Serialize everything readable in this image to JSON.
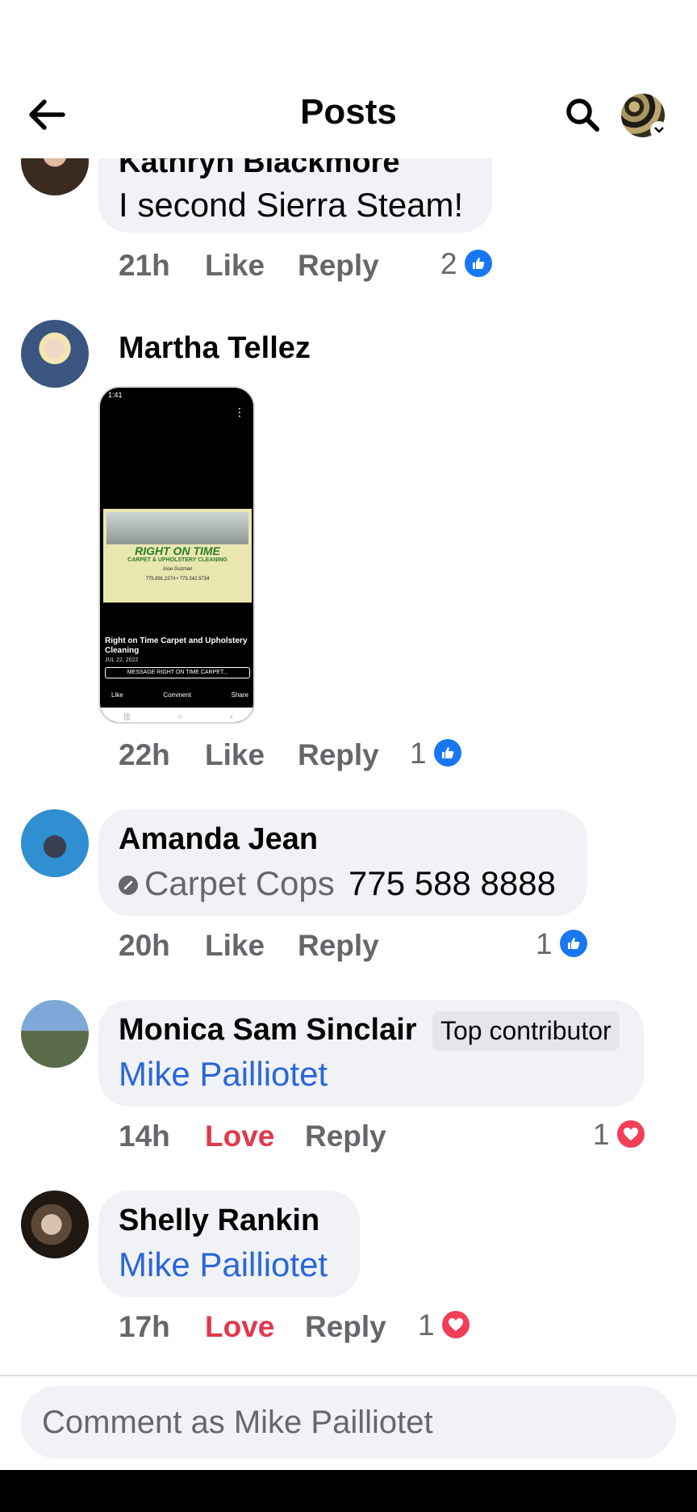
{
  "header": {
    "title": "Posts"
  },
  "comments": [
    {
      "name": "Kathryn Blackmore",
      "text": "I second Sierra Steam!",
      "time": "21h",
      "like_label": "Like",
      "reply_label": "Reply",
      "reaction_count": "2",
      "reaction": "like"
    },
    {
      "name": "Martha Tellez",
      "time": "22h",
      "like_label": "Like",
      "reply_label": "Reply",
      "reaction_count": "1",
      "reaction": "like",
      "attachment": {
        "status_time": "1:41",
        "card_brand": "RIGHT ON TIME",
        "card_subtitle": "CARPET & UPHOLSTERY CLEANING",
        "card_owner": "Jose Guzman",
        "card_phones": "775.891.2274 • 775.342.5734",
        "post_title": "Right on Time Carpet and Upholstery Cleaning",
        "post_date": "JUL 22, 2022",
        "message_button": "MESSAGE RIGHT ON TIME CARPET...",
        "actions": [
          "Like",
          "Comment",
          "Share"
        ]
      }
    },
    {
      "name": "Amanda Jean",
      "mention": "Carpet Cops",
      "text": "775 588 8888",
      "time": "20h",
      "like_label": "Like",
      "reply_label": "Reply",
      "reaction_count": "1",
      "reaction": "like"
    },
    {
      "name": "Monica Sam Sinclair",
      "badge": "Top contributor",
      "mention": "Mike Pailliotet",
      "time": "14h",
      "like_label": "Love",
      "reply_label": "Reply",
      "reaction_count": "1",
      "reaction": "love"
    },
    {
      "name": "Shelly Rankin",
      "mention": "Mike Pailliotet",
      "time": "17h",
      "like_label": "Love",
      "reply_label": "Reply",
      "reaction_count": "1",
      "reaction": "love"
    }
  ],
  "composer": {
    "placeholder": "Comment as Mike Pailliotet"
  },
  "colors": {
    "like_blue": "#1877f2",
    "love_red": "#e0394d",
    "mention_blue": "#2a66d9",
    "bubble_bg": "#f0f2f5",
    "meta_gray": "#65676b"
  }
}
